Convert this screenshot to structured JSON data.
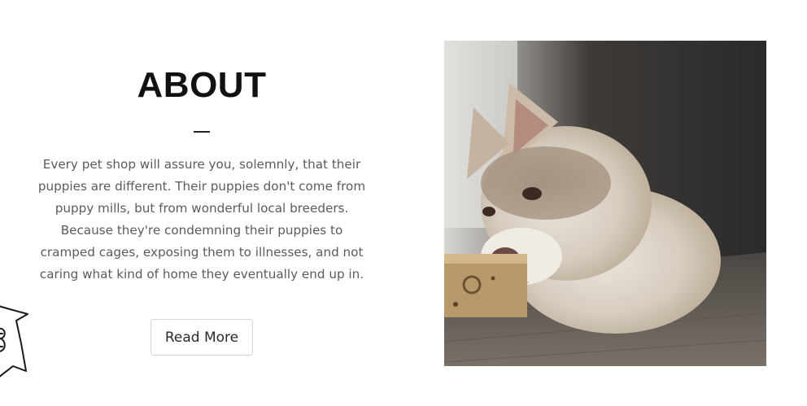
{
  "about": {
    "title": "ABOUT",
    "body": "Every pet shop will assure you, solemnly, that their puppies are different. Their puppies don't come from puppy mills, but from wonderful local breeders. Because they're condemning their puppies to cramped cages, exposing them to illnesses, and not caring what kind of home they eventually end up in.",
    "button_label": "Read More"
  },
  "media": {
    "photo_subject": "puppy-chewing-photo",
    "decor_icon": "cat-doodle-icon"
  },
  "colors": {
    "title": "#111111",
    "body_text": "#5b5b5b",
    "button_border": "#d4d4d4",
    "background": "#ffffff"
  }
}
